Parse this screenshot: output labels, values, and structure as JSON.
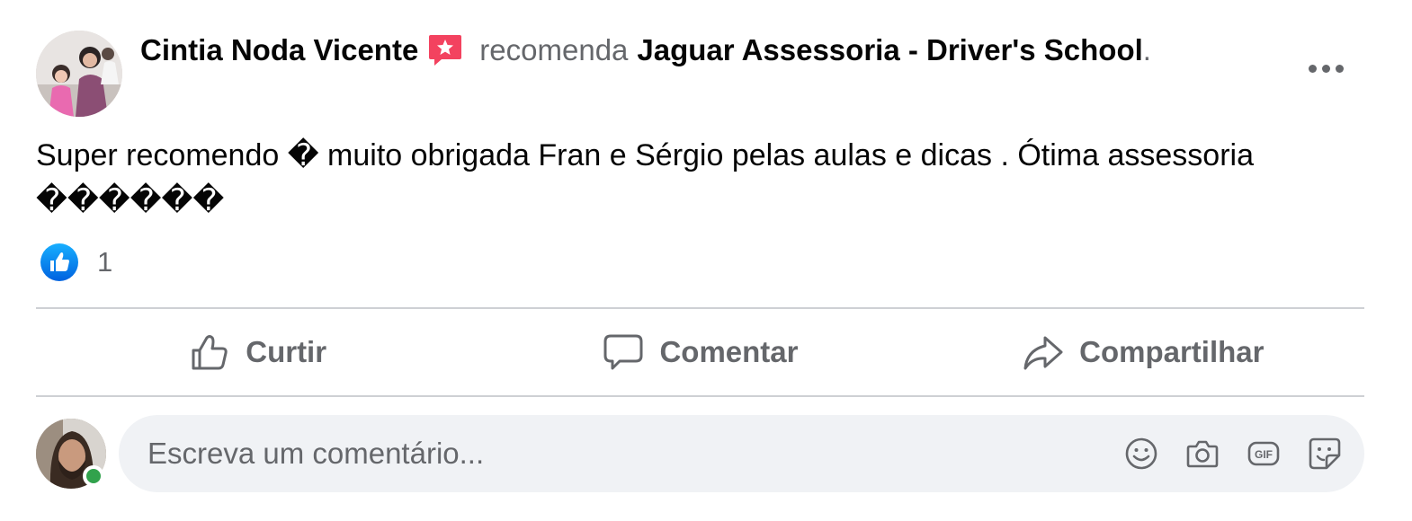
{
  "post": {
    "author": "Cintia Noda Vicente",
    "verb": "recomenda",
    "page": "Jaguar Assessoria - Driver's School",
    "period": ".",
    "text": "Super recomendo � muito obrigada Fran e Sérgio pelas aulas e dicas . Ótima assessoria\n������",
    "reaction_count": "1"
  },
  "actions": {
    "like": "Curtir",
    "comment": "Comentar",
    "share": "Compartilhar"
  },
  "comment": {
    "placeholder": "Escreva um comentário..."
  },
  "icons": {
    "recommend": "recommend-star-icon",
    "more": "more-options-icon",
    "like_badge": "like-reaction-icon",
    "like": "thumbs-up-icon",
    "comment": "speech-bubble-icon",
    "share": "share-arrow-icon",
    "emoji": "smiley-icon",
    "photo": "camera-icon",
    "gif": "gif-icon",
    "sticker": "sticker-icon"
  },
  "colors": {
    "text": "#050505",
    "secondary": "#65676b",
    "accent_blue": "#1877f2",
    "recommend_red": "#f3425f",
    "online_green": "#31a24c",
    "input_bg": "#f0f2f5"
  }
}
